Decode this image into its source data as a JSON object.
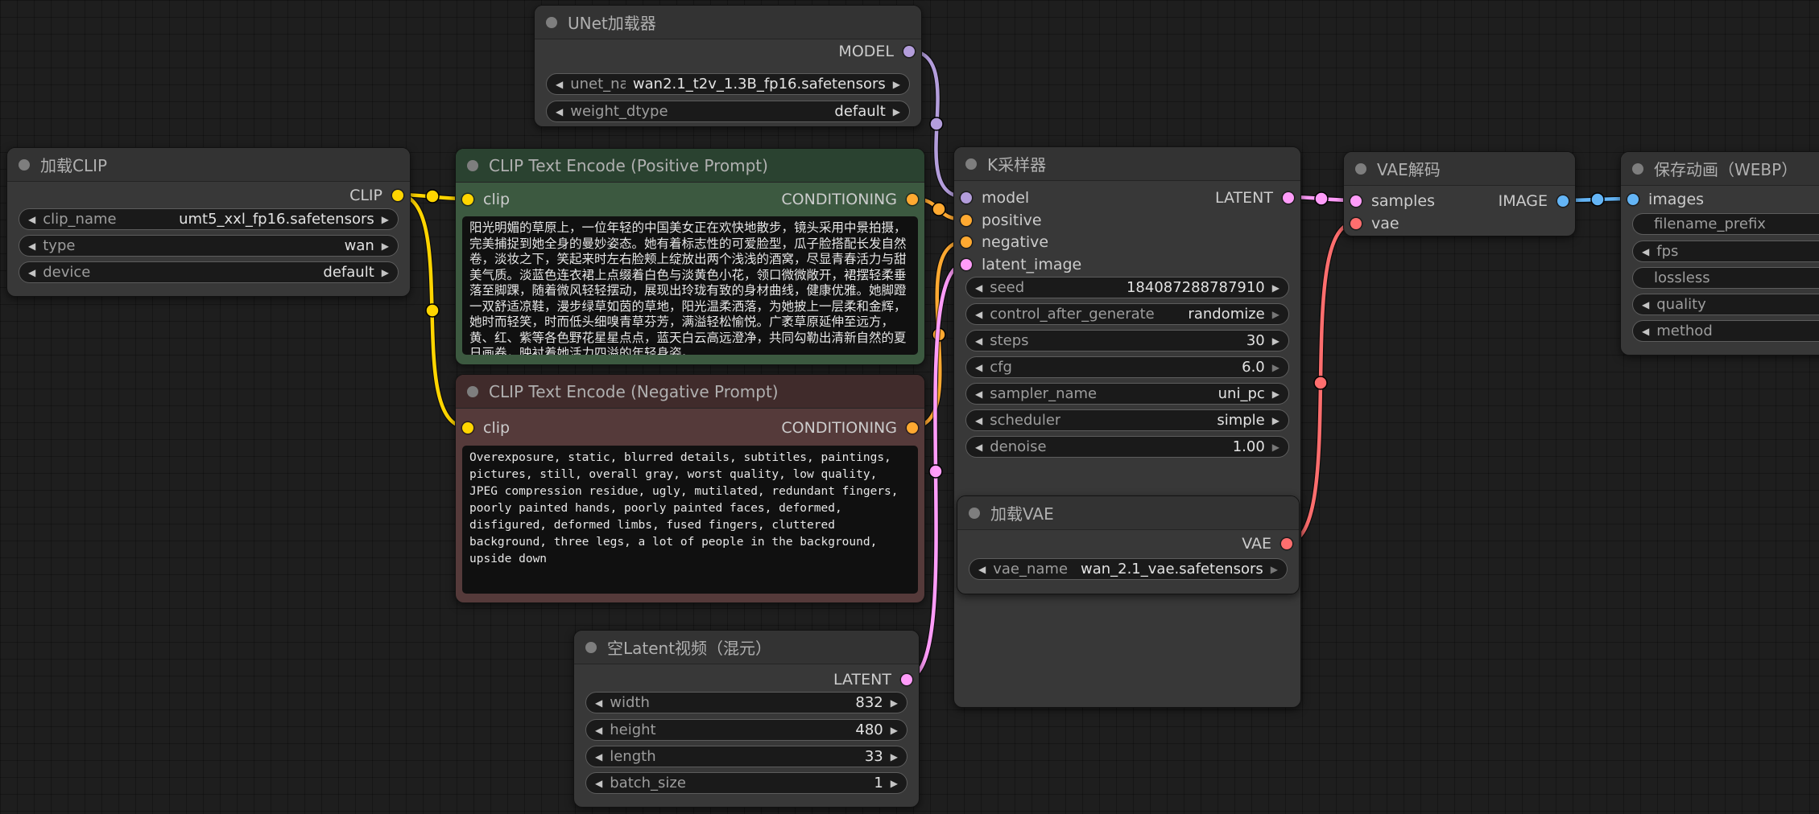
{
  "app": {
    "name": "ComfyUI workflow graph"
  },
  "colors": {
    "model": "#B39DDB",
    "clip": "#FFD500",
    "conditioning": "#FFA931",
    "latent": "#FF9CF9",
    "vae": "#FF6E6E",
    "image": "#64B5F6"
  },
  "nodes": {
    "unet_loader": {
      "title": "UNet加载器",
      "outputs": [
        {
          "label": "MODEL"
        }
      ],
      "widgets": [
        {
          "label": "unet_name",
          "value": "wan2.1_t2v_1.3B_fp16.safetensors"
        },
        {
          "label": "weight_dtype",
          "value": "default"
        }
      ]
    },
    "clip_loader": {
      "title": "加载CLIP",
      "outputs": [
        {
          "label": "CLIP"
        }
      ],
      "widgets": [
        {
          "label": "clip_name",
          "value": "umt5_xxl_fp16.safetensors"
        },
        {
          "label": "type",
          "value": "wan"
        },
        {
          "label": "device",
          "value": "default"
        }
      ]
    },
    "positive_prompt": {
      "title": "CLIP Text Encode (Positive Prompt)",
      "inputs": [
        {
          "label": "clip"
        }
      ],
      "outputs": [
        {
          "label": "CONDITIONING"
        }
      ],
      "text": "阳光明媚的草原上，一位年轻的中国美女正在欢快地散步，镜头采用中景拍摄，完美捕捉到她全身的曼妙姿态。她有着标志性的可爱脸型，瓜子脸搭配长发自然卷，淡妆之下，笑起来时左右脸颊上绽放出两个浅浅的酒窝，尽显青春活力与甜美气质。淡蓝色连衣裙上点缀着白色与淡黄色小花，领口微微敞开，裙摆轻柔垂落至脚踝，随着微风轻轻摆动，展现出玲珑有致的身材曲线，健康优雅。她脚蹬一双舒适凉鞋，漫步绿草如茵的草地，阳光温柔洒落，为她披上一层柔和金辉，她时而轻笑，时而低头细嗅青草芬芳，满溢轻松愉悦。广袤草原延伸至远方，黄、红、紫等各色野花星星点点，蓝天白云高远澄净，共同勾勒出清新自然的夏日画卷，映衬着她活力四溢的年轻身姿。"
    },
    "negative_prompt": {
      "title": "CLIP Text Encode (Negative Prompt)",
      "inputs": [
        {
          "label": "clip"
        }
      ],
      "outputs": [
        {
          "label": "CONDITIONING"
        }
      ],
      "text": "Overexposure, static, blurred details, subtitles, paintings, pictures, still, overall gray, worst quality, low quality, JPEG compression residue, ugly, mutilated, redundant fingers, poorly painted hands, poorly painted faces, deformed, disfigured, deformed limbs, fused fingers, cluttered background, three legs, a lot of people in the background, upside down"
    },
    "empty_latent_video": {
      "title": "空Latent视频（混元）",
      "outputs": [
        {
          "label": "LATENT"
        }
      ],
      "widgets": [
        {
          "label": "width",
          "value": "832"
        },
        {
          "label": "height",
          "value": "480"
        },
        {
          "label": "length",
          "value": "33"
        },
        {
          "label": "batch_size",
          "value": "1"
        }
      ]
    },
    "ksampler": {
      "title": "K采样器",
      "inputs": [
        {
          "label": "model"
        },
        {
          "label": "positive"
        },
        {
          "label": "negative"
        },
        {
          "label": "latent_image"
        }
      ],
      "outputs": [
        {
          "label": "LATENT"
        }
      ],
      "widgets": [
        {
          "label": "seed",
          "value": "184087288787910"
        },
        {
          "label": "control_after_generate",
          "value": "randomize"
        },
        {
          "label": "steps",
          "value": "30"
        },
        {
          "label": "cfg",
          "value": "6.0"
        },
        {
          "label": "sampler_name",
          "value": "uni_pc"
        },
        {
          "label": "scheduler",
          "value": "simple"
        },
        {
          "label": "denoise",
          "value": "1.00"
        }
      ]
    },
    "vae_loader": {
      "title": "加载VAE",
      "outputs": [
        {
          "label": "VAE"
        }
      ],
      "widgets": [
        {
          "label": "vae_name",
          "value": "wan_2.1_vae.safetensors"
        }
      ]
    },
    "vae_decode": {
      "title": "VAE解码",
      "inputs": [
        {
          "label": "samples"
        },
        {
          "label": "vae"
        }
      ],
      "outputs": [
        {
          "label": "IMAGE"
        }
      ]
    },
    "save_webp": {
      "title": "保存动画（WEBP）",
      "inputs": [
        {
          "label": "images"
        }
      ],
      "widgets": [
        {
          "label": "filename_prefix"
        },
        {
          "label": "fps"
        },
        {
          "label": "lossless"
        },
        {
          "label": "quality"
        },
        {
          "label": "method"
        }
      ]
    }
  }
}
